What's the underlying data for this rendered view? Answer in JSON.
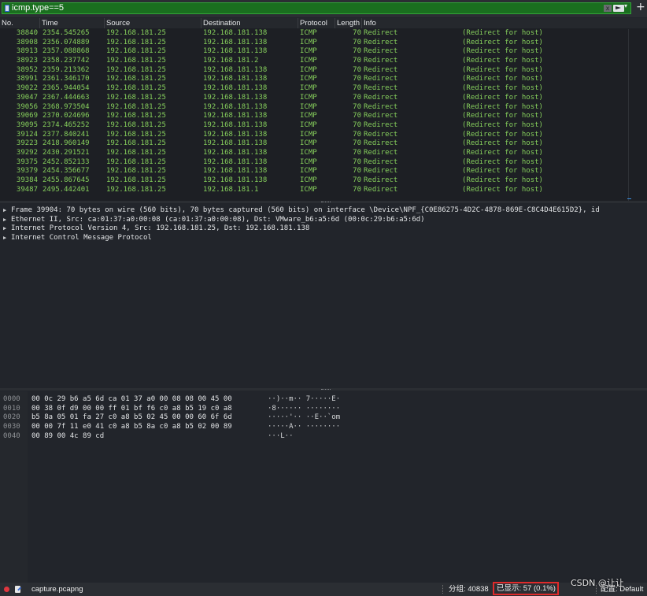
{
  "filter": {
    "value": "icmp.type==5",
    "clear_glyph": "x",
    "add_glyph": "+"
  },
  "packet_list": {
    "columns": [
      "No.",
      "Time",
      "Source",
      "Destination",
      "Protocol",
      "Length",
      "Info"
    ],
    "rows": [
      {
        "no": "38840",
        "time": "2354.545265",
        "src": "192.168.181.25",
        "dst": "192.168.181.138",
        "proto": "ICMP",
        "len": "70",
        "info": "Redirect",
        "extra": "(Redirect for host)"
      },
      {
        "no": "38908",
        "time": "2356.074889",
        "src": "192.168.181.25",
        "dst": "192.168.181.138",
        "proto": "ICMP",
        "len": "70",
        "info": "Redirect",
        "extra": "(Redirect for host)"
      },
      {
        "no": "38913",
        "time": "2357.088868",
        "src": "192.168.181.25",
        "dst": "192.168.181.138",
        "proto": "ICMP",
        "len": "70",
        "info": "Redirect",
        "extra": "(Redirect for host)"
      },
      {
        "no": "38923",
        "time": "2358.237742",
        "src": "192.168.181.25",
        "dst": "192.168.181.2",
        "proto": "ICMP",
        "len": "70",
        "info": "Redirect",
        "extra": "(Redirect for host)"
      },
      {
        "no": "38952",
        "time": "2359.213362",
        "src": "192.168.181.25",
        "dst": "192.168.181.138",
        "proto": "ICMP",
        "len": "70",
        "info": "Redirect",
        "extra": "(Redirect for host)"
      },
      {
        "no": "38991",
        "time": "2361.346170",
        "src": "192.168.181.25",
        "dst": "192.168.181.138",
        "proto": "ICMP",
        "len": "70",
        "info": "Redirect",
        "extra": "(Redirect for host)"
      },
      {
        "no": "39022",
        "time": "2365.944054",
        "src": "192.168.181.25",
        "dst": "192.168.181.138",
        "proto": "ICMP",
        "len": "70",
        "info": "Redirect",
        "extra": "(Redirect for host)"
      },
      {
        "no": "39047",
        "time": "2367.444663",
        "src": "192.168.181.25",
        "dst": "192.168.181.138",
        "proto": "ICMP",
        "len": "70",
        "info": "Redirect",
        "extra": "(Redirect for host)"
      },
      {
        "no": "39056",
        "time": "2368.973504",
        "src": "192.168.181.25",
        "dst": "192.168.181.138",
        "proto": "ICMP",
        "len": "70",
        "info": "Redirect",
        "extra": "(Redirect for host)"
      },
      {
        "no": "39069",
        "time": "2370.024696",
        "src": "192.168.181.25",
        "dst": "192.168.181.138",
        "proto": "ICMP",
        "len": "70",
        "info": "Redirect",
        "extra": "(Redirect for host)"
      },
      {
        "no": "39095",
        "time": "2374.465252",
        "src": "192.168.181.25",
        "dst": "192.168.181.138",
        "proto": "ICMP",
        "len": "70",
        "info": "Redirect",
        "extra": "(Redirect for host)"
      },
      {
        "no": "39124",
        "time": "2377.840241",
        "src": "192.168.181.25",
        "dst": "192.168.181.138",
        "proto": "ICMP",
        "len": "70",
        "info": "Redirect",
        "extra": "(Redirect for host)"
      },
      {
        "no": "39223",
        "time": "2418.960149",
        "src": "192.168.181.25",
        "dst": "192.168.181.138",
        "proto": "ICMP",
        "len": "70",
        "info": "Redirect",
        "extra": "(Redirect for host)"
      },
      {
        "no": "39292",
        "time": "2430.291521",
        "src": "192.168.181.25",
        "dst": "192.168.181.138",
        "proto": "ICMP",
        "len": "70",
        "info": "Redirect",
        "extra": "(Redirect for host)"
      },
      {
        "no": "39375",
        "time": "2452.852133",
        "src": "192.168.181.25",
        "dst": "192.168.181.138",
        "proto": "ICMP",
        "len": "70",
        "info": "Redirect",
        "extra": "(Redirect for host)"
      },
      {
        "no": "39379",
        "time": "2454.356677",
        "src": "192.168.181.25",
        "dst": "192.168.181.138",
        "proto": "ICMP",
        "len": "70",
        "info": "Redirect",
        "extra": "(Redirect for host)"
      },
      {
        "no": "39384",
        "time": "2455.867645",
        "src": "192.168.181.25",
        "dst": "192.168.181.138",
        "proto": "ICMP",
        "len": "70",
        "info": "Redirect",
        "extra": "(Redirect for host)"
      },
      {
        "no": "39487",
        "time": "2495.442401",
        "src": "192.168.181.25",
        "dst": "192.168.181.1",
        "proto": "ICMP",
        "len": "70",
        "info": "Redirect",
        "extra": "(Redirect for host)"
      }
    ]
  },
  "details": [
    "Frame 39904: 70 bytes on wire (560 bits), 70 bytes captured (560 bits) on interface \\Device\\NPF_{C0E86275-4D2C-4878-869E-C8C4D4E615D2}, id",
    "Ethernet II, Src: ca:01:37:a0:00:08 (ca:01:37:a0:00:08), Dst: VMware_b6:a5:6d (00:0c:29:b6:a5:6d)",
    "Internet Protocol Version 4, Src: 192.168.181.25, Dst: 192.168.181.138",
    "Internet Control Message Protocol"
  ],
  "bytes": [
    {
      "offset": "0000",
      "hex": "00 0c 29 b6 a5 6d ca 01  37 a0 00 08 08 00 45 00",
      "ascii": "··)··m·· 7·····E·"
    },
    {
      "offset": "0010",
      "hex": "00 38 0f d9 00 00 ff 01  bf f6 c0 a8 b5 19 c0 a8",
      "ascii": "·8······ ········"
    },
    {
      "offset": "0020",
      "hex": "b5 8a 05 01 fa 27 c0 a8  b5 02 45 00 00 60 6f 6d",
      "ascii": "·····'·· ··E··`om"
    },
    {
      "offset": "0030",
      "hex": "00 00 7f 11 e0 41 c0 a8  b5 8a c0 a8 b5 02 00 89",
      "ascii": "·····A·· ········"
    },
    {
      "offset": "0040",
      "hex": "00 89 00 4c 89 cd",
      "ascii": "···L··"
    }
  ],
  "status": {
    "file": "capture.pcapng",
    "packets": "分组: 40838",
    "displayed": "已显示: 57 (0.1%)",
    "profile": "配置: Default"
  },
  "watermark": "CSDN @让让",
  "colors": {
    "filter_valid": "#1a6f1f",
    "row_text": "#86cf5c",
    "highlight_box": "#e02a2a"
  }
}
